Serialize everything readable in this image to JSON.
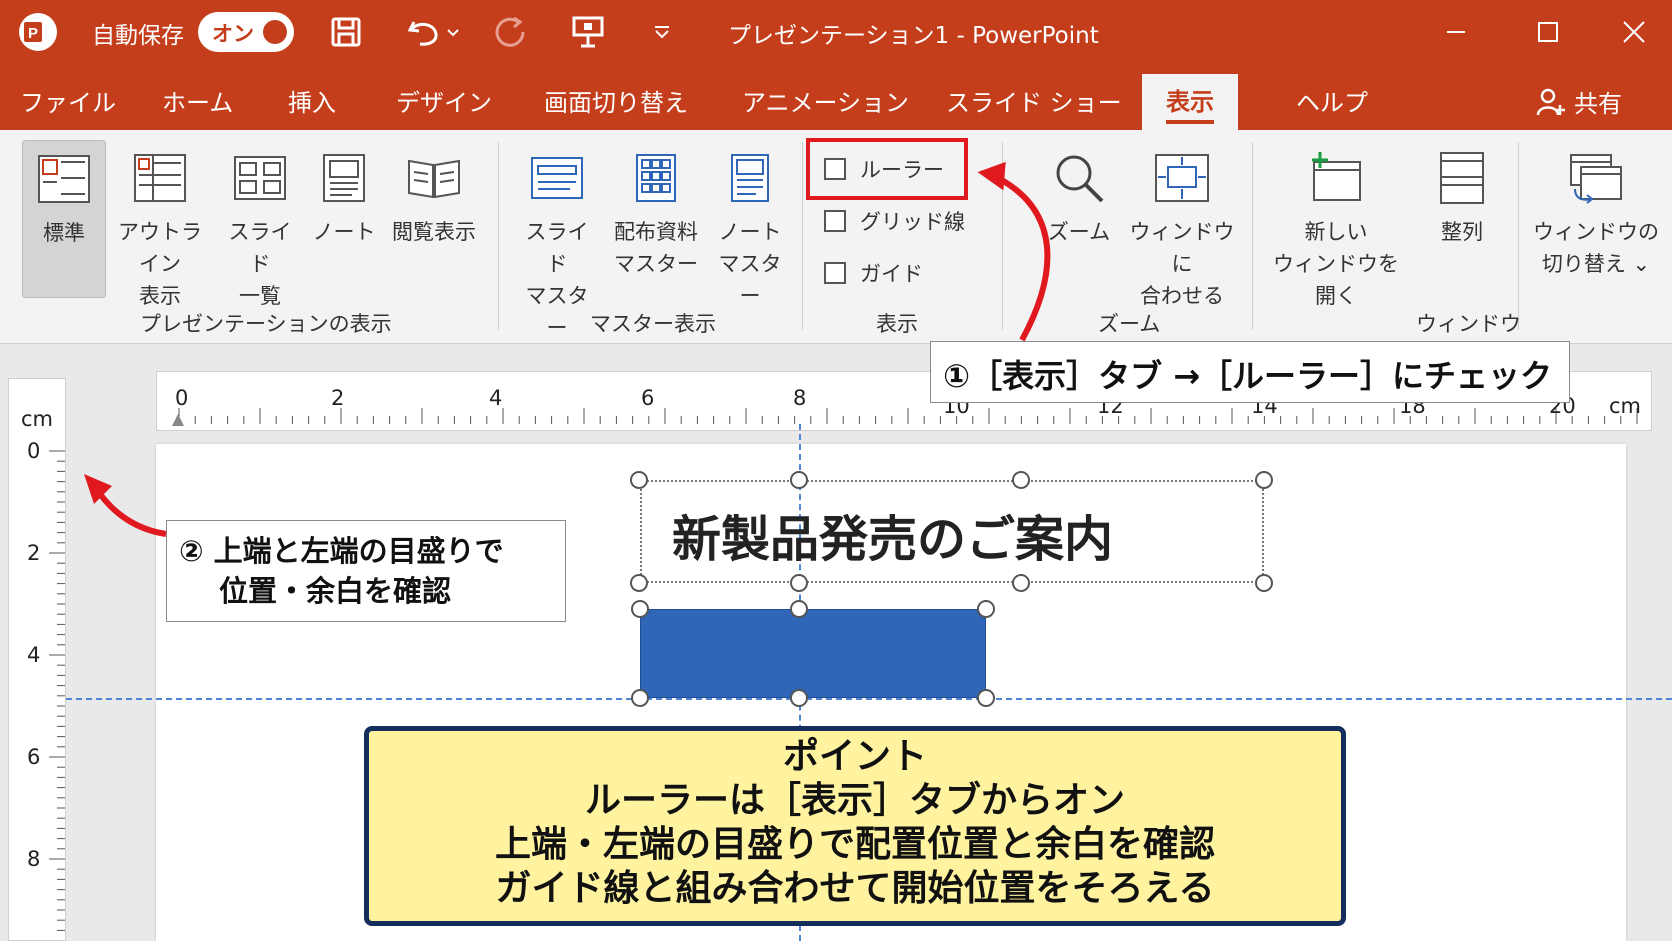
{
  "titlebar": {
    "autosave_label": "自動保存",
    "autosave_state": "オン",
    "title": "プレゼンテーション1  -  PowerPoint",
    "brand_color": "#c43e1c"
  },
  "menu": {
    "items": [
      "ファイル",
      "ホーム",
      "挿入",
      "デザイン",
      "画面切り替え",
      "アニメーション",
      "スライド ショー",
      "表示",
      "ヘルプ"
    ],
    "active": "表示",
    "share": "共有"
  },
  "ribbon": {
    "presentation_views": {
      "label": "プレゼンテーションの表示",
      "buttons": [
        {
          "line1": "標準",
          "line2": ""
        },
        {
          "line1": "アウトライン",
          "line2": "表示"
        },
        {
          "line1": "スライド",
          "line2": "一覧"
        },
        {
          "line1": "ノート",
          "line2": ""
        },
        {
          "line1": "閲覧表示",
          "line2": ""
        }
      ]
    },
    "master_views": {
      "label": "マスター表示",
      "buttons": [
        {
          "line1": "スライド",
          "line2": "マスター"
        },
        {
          "line1": "配布資料",
          "line2": "マスター"
        },
        {
          "line1": "ノート",
          "line2": "マスター"
        }
      ]
    },
    "show": {
      "label": "表示",
      "checkboxes": [
        "ルーラー",
        "グリッド線",
        "ガイド"
      ]
    },
    "zoom": {
      "label": "ズーム",
      "buttons": [
        {
          "line1": "ズーム",
          "line2": ""
        },
        {
          "line1": "ウィンドウに",
          "line2": "合わせる"
        }
      ]
    },
    "window": {
      "label": "ウィンドウ",
      "buttons": [
        {
          "line1": "新しい",
          "line2": "ウィンドウを開く"
        },
        {
          "line1": "整列",
          "line2": ""
        },
        {
          "line1": "ウィンドウの",
          "line2": "切り替え ⌄"
        }
      ]
    }
  },
  "rulers": {
    "unit": "cm",
    "horizontal_labels": [
      "0",
      "2",
      "4",
      "6",
      "8",
      "10",
      "12",
      "14",
      "18",
      "20"
    ],
    "vertical_labels": [
      "0",
      "2",
      "4",
      "6",
      "8"
    ]
  },
  "slide": {
    "title": "新製品発売のご案内",
    "shape_color": "#2f66b8"
  },
  "callouts": {
    "step1": "①［表示］タブ →［ルーラー］にチェック",
    "step2_line1": "② 上端と左端の目盛りで",
    "step2_line2": "位置・余白を確認"
  },
  "point": {
    "lines": [
      "ポイント",
      "ルーラーは［表示］タブからオン",
      "上端・左端の目盛りで配置位置と余白を確認",
      "ガイド線と組み合わせて開始位置をそろえる"
    ]
  }
}
